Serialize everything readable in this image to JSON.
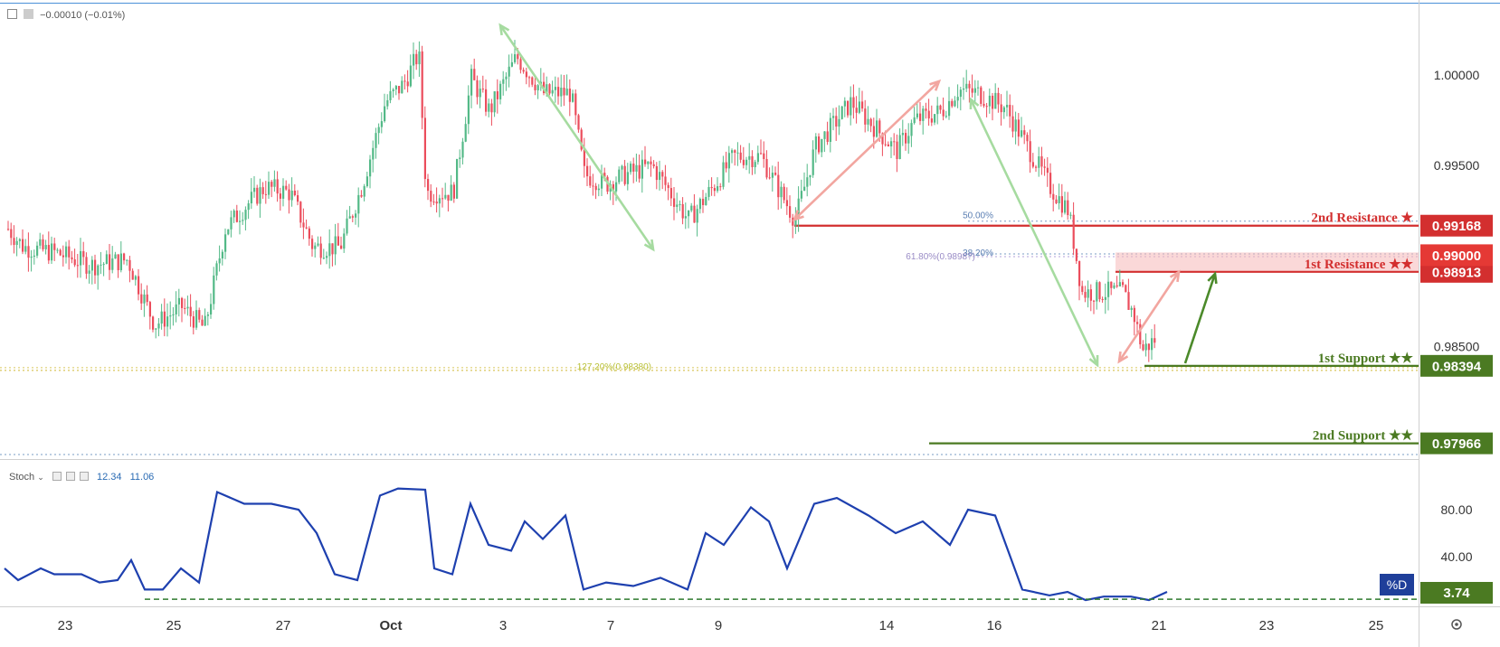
{
  "header": {
    "change_text": "−0.00010 (−0.01%)",
    "indicator_name": "Stoch",
    "stoch_k": "12.34",
    "stoch_d": "11.06"
  },
  "colors": {
    "up": "#53b987",
    "down": "#eb4d5c",
    "resistance": "#d32f2f",
    "support": "#4b7a22",
    "stoch_line": "#1e40af",
    "axis_text": "#333333",
    "arrow_green": "#a6dba0",
    "arrow_red": "#f2a6a0"
  },
  "price_axis": {
    "ticks": [
      "1.00000",
      "0.99500",
      "0.98500"
    ],
    "tick_values": [
      1.0,
      0.995,
      0.985
    ]
  },
  "time_axis": {
    "labels": [
      "23",
      "25",
      "27",
      "Oct",
      "3",
      "7",
      "9",
      "14",
      "16",
      "21",
      "23",
      "25"
    ]
  },
  "levels": [
    {
      "name": "2nd Resistance ★",
      "value": 0.99168,
      "price_label": "0.99168",
      "kind": "resistance"
    },
    {
      "name": "1st Resistance ★★",
      "value": 0.98913,
      "price_label": "0.98913",
      "kind": "resistance"
    },
    {
      "name": "1st Support ★★",
      "value": 0.98394,
      "price_label": "0.98394",
      "kind": "support"
    },
    {
      "name": "2nd Support ★★",
      "value": 0.97966,
      "price_label": "0.97966",
      "kind": "support"
    }
  ],
  "current_price": {
    "value": 0.99,
    "label": "0.99000"
  },
  "fib_labels": {
    "f50": "50.00%",
    "f382": "38.20%",
    "f618": "61.80%(0.9898?)",
    "f1272": "127.20%(0.98380)"
  },
  "stoch_axis": {
    "ticks": [
      "80.00",
      "40.00"
    ],
    "tick_values": [
      80,
      40
    ],
    "d_badge": "%D",
    "d_value": "3.74"
  },
  "chart_data": {
    "type": "line",
    "title": "",
    "xlabel": "",
    "ylabel": "",
    "x": [
      "23",
      "25",
      "27",
      "Oct",
      "3",
      "7",
      "9",
      "14",
      "16",
      "21"
    ],
    "ylim": [
      0.9764,
      1.0033
    ],
    "series": [
      {
        "name": "",
        "values": [
          0.989,
          0.9862,
          0.9942,
          1.0012,
          1.0012,
          0.9945,
          0.9925,
          0.9975,
          0.9988,
          0.9849
        ]
      }
    ]
  }
}
